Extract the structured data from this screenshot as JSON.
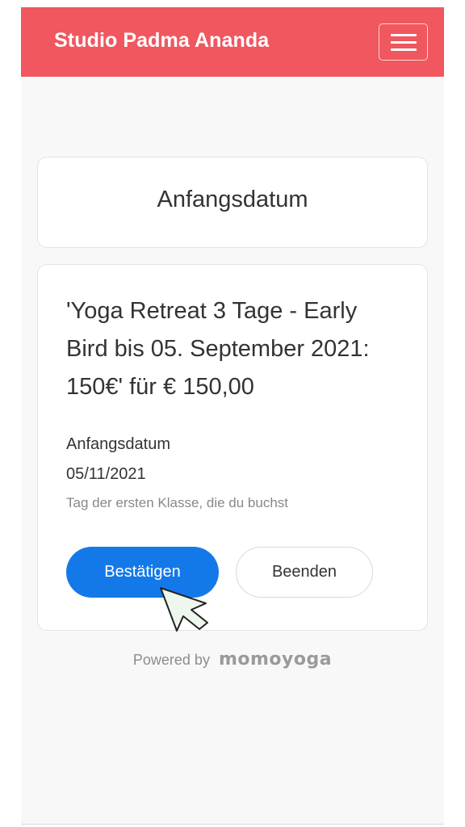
{
  "header": {
    "brand": "Studio Padma Ananda",
    "menu_icon": "hamburger-menu-icon",
    "color": "#f0575f"
  },
  "title_card": {
    "title": "Anfangsdatum"
  },
  "booking": {
    "product": "'Yoga Retreat 3 Tage - Early Bird bis 05. September 2021: 150€' für € 150,00",
    "start_date_label": "Anfangsdatum",
    "start_date_value": "05/11/2021",
    "start_date_help": "Tag der ersten Klasse, die du buchst",
    "confirm_label": "Bestätigen",
    "cancel_label": "Beenden",
    "confirm_color": "#1479e8"
  },
  "footer": {
    "powered_by": "Powered by",
    "logo_text": "momoyoga"
  },
  "cursor_icon": "arrow-pointer-icon"
}
